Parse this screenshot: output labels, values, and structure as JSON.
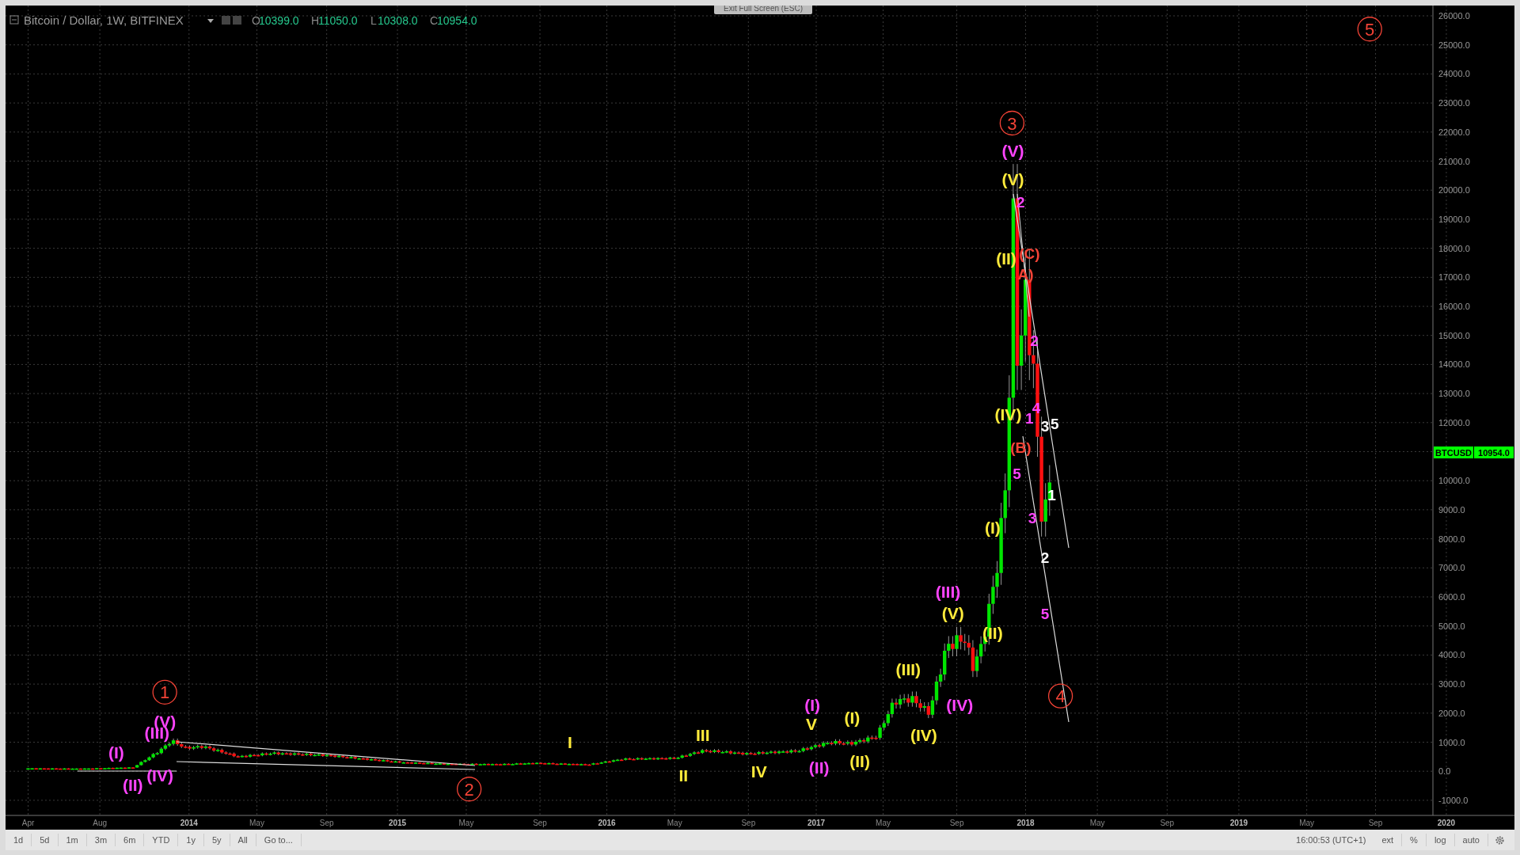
{
  "header": {
    "symbol": "Bitcoin / Dollar, 1W, BITFINEX",
    "ohlc": [
      {
        "label": "O",
        "value": "10399.0"
      },
      {
        "label": "H",
        "value": "11050.0"
      },
      {
        "label": "L",
        "value": "10308.0"
      },
      {
        "label": "C",
        "value": "10954.0"
      }
    ]
  },
  "exit_button": "Exit Full Screen (ESC)",
  "price_axis": {
    "ticks": [
      "26000.0",
      "25000.0",
      "24000.0",
      "23000.0",
      "22000.0",
      "21000.0",
      "20000.0",
      "19000.0",
      "18000.0",
      "17000.0",
      "16000.0",
      "15000.0",
      "14000.0",
      "13000.0",
      "12000.0",
      "10000.0",
      "9000.0",
      "8000.0",
      "7000.0",
      "6000.0",
      "5000.0",
      "4000.0",
      "3000.0",
      "2000.0",
      "1000.0",
      "0.0",
      "-1000.0"
    ],
    "tag_symbol": "BTCUSD",
    "tag_value": "10954.0"
  },
  "time_axis": [
    {
      "text": "Apr",
      "kind": "month"
    },
    {
      "text": "Aug",
      "kind": "month"
    },
    {
      "text": "2014",
      "kind": "year"
    },
    {
      "text": "May",
      "kind": "month"
    },
    {
      "text": "Sep",
      "kind": "month"
    },
    {
      "text": "2015",
      "kind": "year"
    },
    {
      "text": "May",
      "kind": "month"
    },
    {
      "text": "Sep",
      "kind": "month"
    },
    {
      "text": "2016",
      "kind": "year"
    },
    {
      "text": "May",
      "kind": "month"
    },
    {
      "text": "Sep",
      "kind": "month"
    },
    {
      "text": "2017",
      "kind": "year"
    },
    {
      "text": "May",
      "kind": "month"
    },
    {
      "text": "Sep",
      "kind": "month"
    },
    {
      "text": "2018",
      "kind": "year"
    },
    {
      "text": "May",
      "kind": "month"
    },
    {
      "text": "Sep",
      "kind": "month"
    },
    {
      "text": "2019",
      "kind": "year"
    },
    {
      "text": "May",
      "kind": "month"
    },
    {
      "text": "Sep",
      "kind": "month"
    },
    {
      "text": "2020",
      "kind": "year"
    }
  ],
  "annotations": [
    {
      "text": "5",
      "kind": "circled",
      "color": "#f44336"
    },
    {
      "text": "3",
      "kind": "circled",
      "color": "#f44336"
    },
    {
      "text": "(V)",
      "kind": "wave",
      "color": "#ff44ff"
    },
    {
      "text": "(V)",
      "kind": "wave",
      "color": "#ffeb3b"
    },
    {
      "text": "2",
      "kind": "count",
      "color": "#ff44ff"
    },
    {
      "text": "(C)",
      "kind": "count",
      "color": "#f44336"
    },
    {
      "text": "(II)",
      "kind": "wave",
      "color": "#ffeb3b"
    },
    {
      "text": "A)",
      "kind": "count",
      "color": "#f44336"
    },
    {
      "text": "2",
      "kind": "count",
      "color": "#ff44ff"
    },
    {
      "text": "4",
      "kind": "count",
      "color": "#ff44ff"
    },
    {
      "text": "(IV)",
      "kind": "wave",
      "color": "#ffeb3b"
    },
    {
      "text": "1",
      "kind": "count",
      "color": "#ff44ff"
    },
    {
      "text": "3",
      "kind": "count",
      "color": "#ffffff"
    },
    {
      "text": "5",
      "kind": "count",
      "color": "#ffffff"
    },
    {
      "text": "(B)",
      "kind": "count",
      "color": "#f44336"
    },
    {
      "text": "5",
      "kind": "count",
      "color": "#ff44ff"
    },
    {
      "text": "1",
      "kind": "count",
      "color": "#ffffff"
    },
    {
      "text": "3",
      "kind": "count",
      "color": "#ff44ff"
    },
    {
      "text": "(I)",
      "kind": "wave",
      "color": "#ffeb3b"
    },
    {
      "text": "2",
      "kind": "count",
      "color": "#ffffff"
    },
    {
      "text": "(III)",
      "kind": "wave",
      "color": "#ff44ff"
    },
    {
      "text": "(V)",
      "kind": "wave",
      "color": "#ffeb3b"
    },
    {
      "text": "5",
      "kind": "count",
      "color": "#ff44ff"
    },
    {
      "text": "(II)",
      "kind": "wave",
      "color": "#ffeb3b"
    },
    {
      "text": "(III)",
      "kind": "wave",
      "color": "#ffeb3b"
    },
    {
      "text": "1",
      "kind": "circled",
      "color": "#f44336"
    },
    {
      "text": "4",
      "kind": "circled",
      "color": "#f44336"
    },
    {
      "text": "(I)",
      "kind": "wave",
      "color": "#ff44ff"
    },
    {
      "text": "(IV)",
      "kind": "wave",
      "color": "#ff44ff"
    },
    {
      "text": "(V)",
      "kind": "wave",
      "color": "#ff44ff"
    },
    {
      "text": "V",
      "kind": "wave",
      "color": "#ffeb3b"
    },
    {
      "text": "(I)",
      "kind": "wave",
      "color": "#ffeb3b"
    },
    {
      "text": "(III)",
      "kind": "wave",
      "color": "#ff44ff"
    },
    {
      "text": "I",
      "kind": "wave",
      "color": "#ffeb3b"
    },
    {
      "text": "III",
      "kind": "wave",
      "color": "#ffeb3b"
    },
    {
      "text": "(IV)",
      "kind": "wave",
      "color": "#ffeb3b"
    },
    {
      "text": "(I)",
      "kind": "wave",
      "color": "#ff44ff"
    },
    {
      "text": "(IV)",
      "kind": "wave",
      "color": "#ff44ff"
    },
    {
      "text": "II",
      "kind": "wave",
      "color": "#ffeb3b"
    },
    {
      "text": "IV",
      "kind": "wave",
      "color": "#ffeb3b"
    },
    {
      "text": "(II)",
      "kind": "wave",
      "color": "#ff44ff"
    },
    {
      "text": "(II)",
      "kind": "wave",
      "color": "#ffeb3b"
    },
    {
      "text": "(II)",
      "kind": "wave",
      "color": "#ff44ff"
    },
    {
      "text": "2",
      "kind": "circled",
      "color": "#f44336"
    }
  ],
  "toolbar": {
    "ranges": [
      "1d",
      "5d",
      "1m",
      "3m",
      "6m",
      "YTD",
      "1y",
      "5y",
      "All"
    ],
    "goto": "Go to...",
    "clock": "16:00:53 (UTC+1)",
    "options": [
      "ext",
      "%",
      "log",
      "auto"
    ]
  }
}
